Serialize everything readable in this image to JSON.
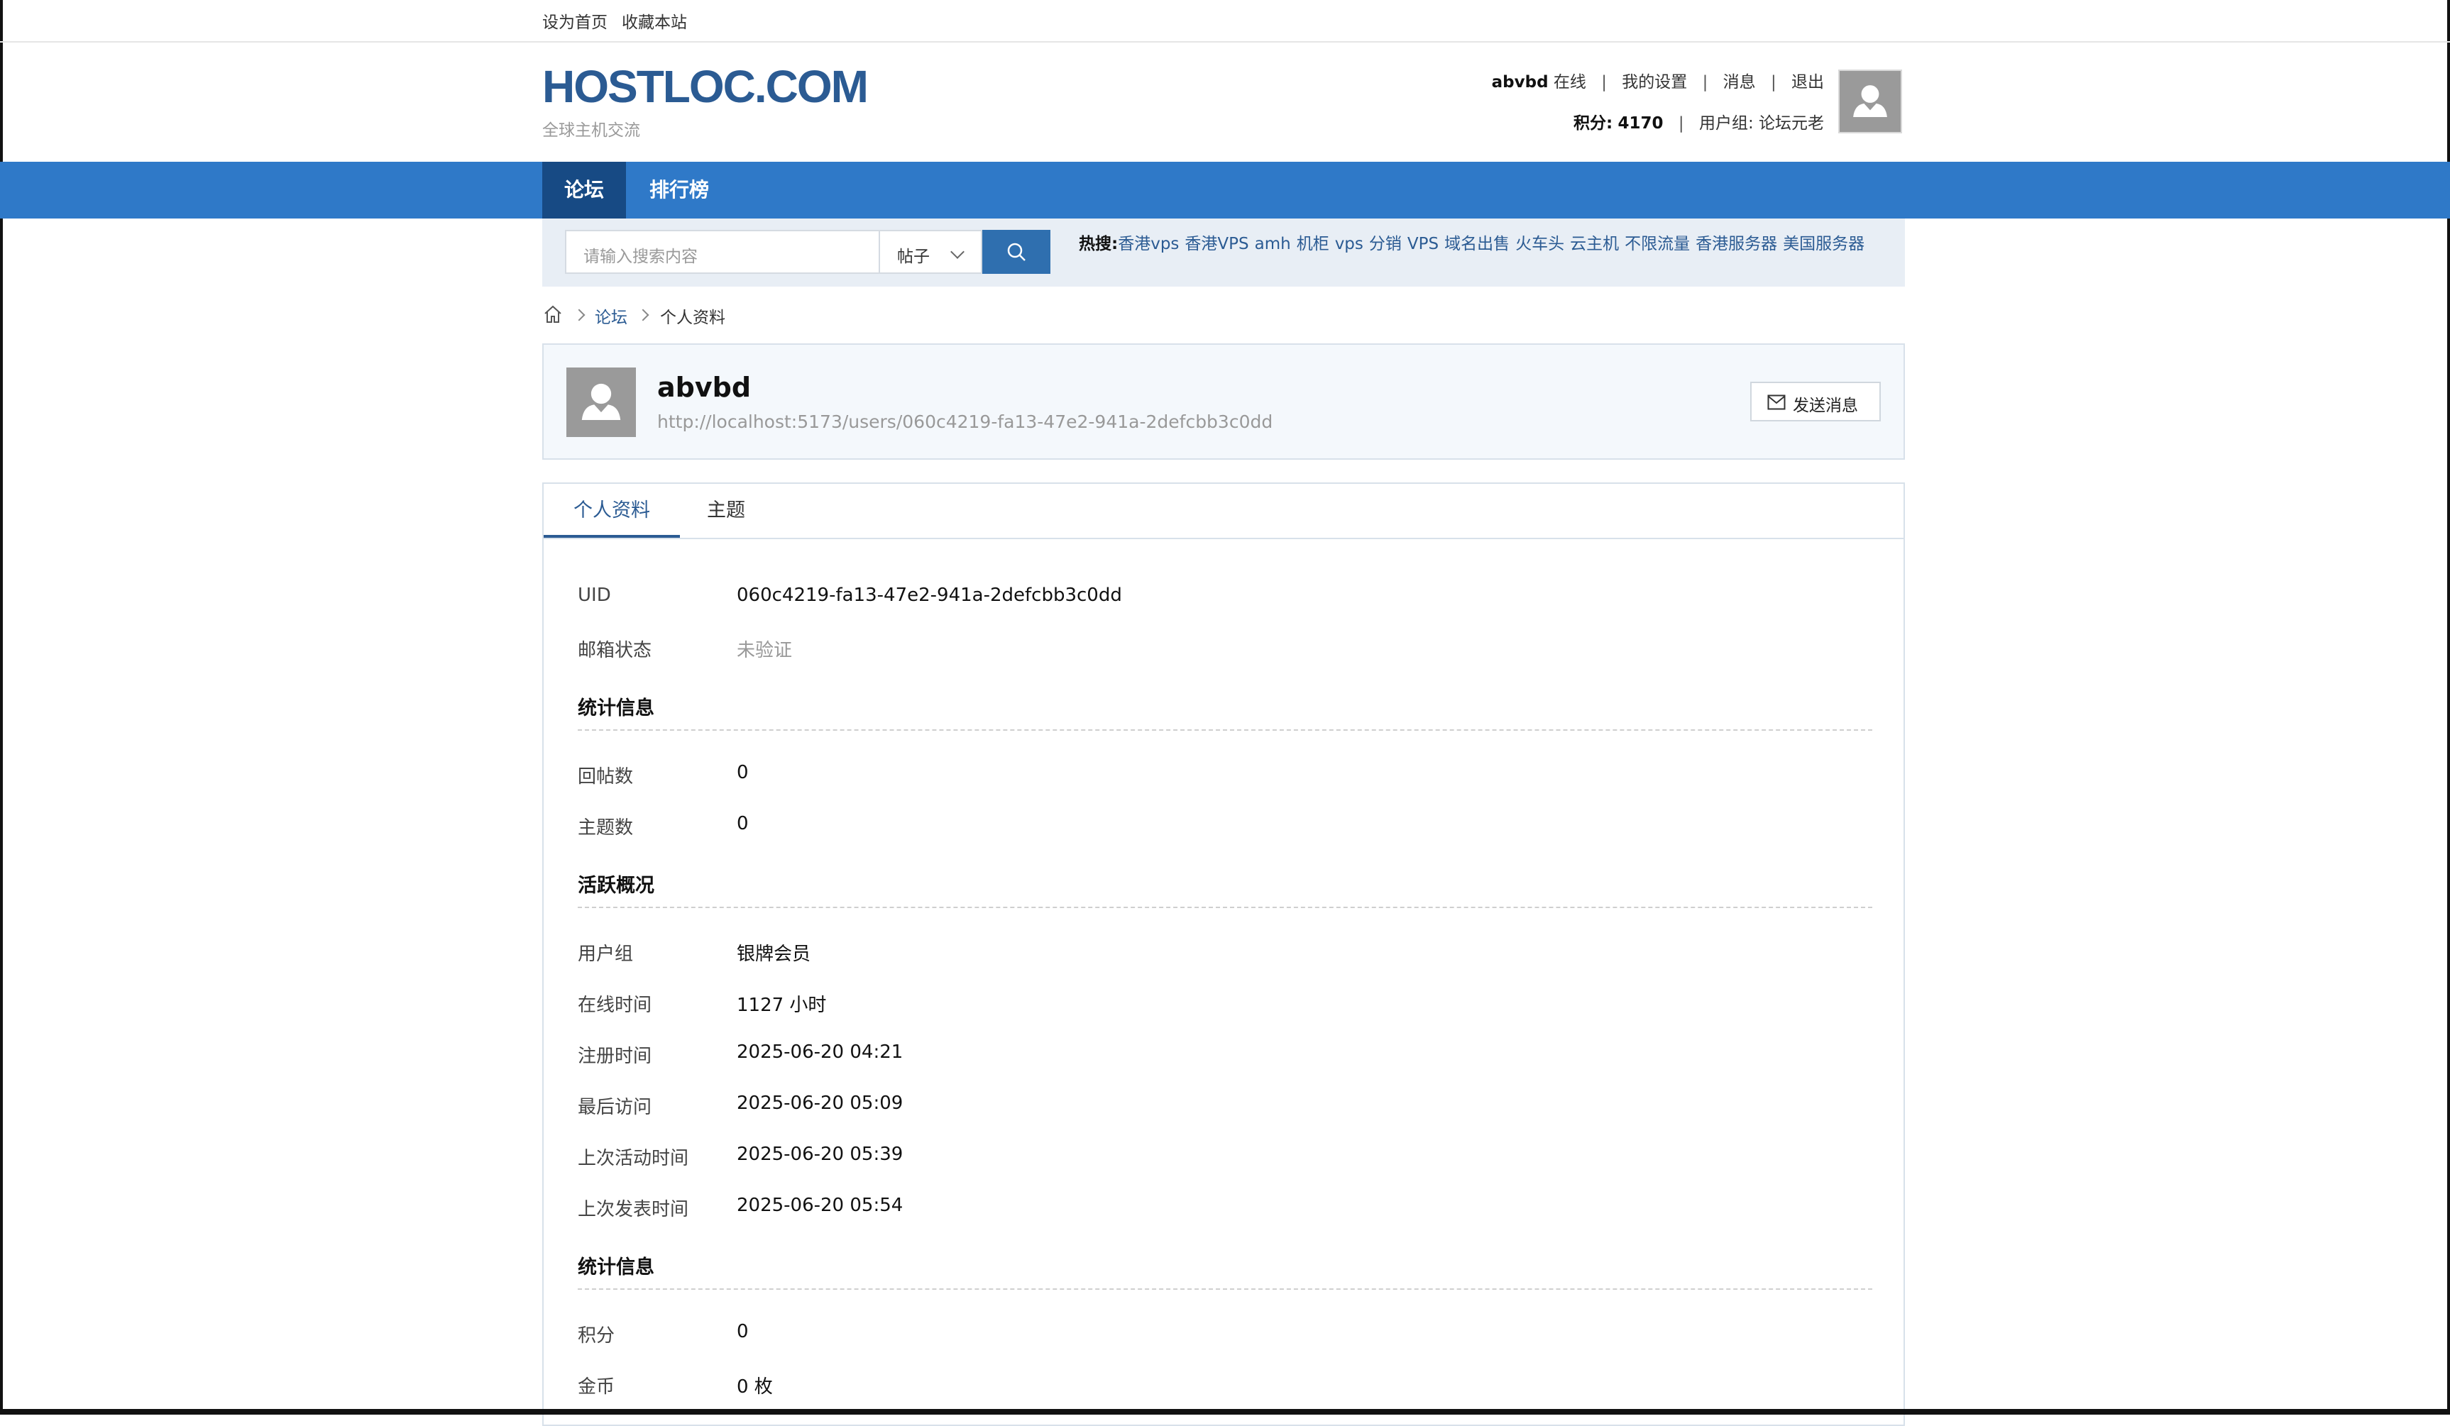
{
  "topbar": {
    "set_home": "设为首页",
    "bookmark": "收藏本站"
  },
  "header": {
    "logo": "HOSTLOC.COM",
    "slogan": "全球主机交流",
    "username": "abvbd",
    "online": "在线",
    "settings": "我的设置",
    "messages": "消息",
    "logout": "退出",
    "credit_label": "积分:",
    "credit_value": "4170",
    "group_label": "用户组:",
    "group_value": "论坛元老"
  },
  "nav": {
    "items": [
      {
        "label": "论坛",
        "active": true
      },
      {
        "label": "排行榜",
        "active": false
      }
    ]
  },
  "search": {
    "placeholder": "请输入搜索内容",
    "type": "帖子",
    "hot_label": "热搜:",
    "hot_terms": [
      "香港vps",
      "香港VPS",
      "amh",
      "机柜",
      "vps",
      "分销",
      "VPS",
      "域名出售",
      "火车头",
      "云主机",
      "不限流量",
      "香港服务器",
      "美国服务器"
    ]
  },
  "breadcrumb": {
    "forum": "论坛",
    "current": "个人资料"
  },
  "profile": {
    "name": "abvbd",
    "url": "http://localhost:5173/users/060c4219-fa13-47e2-941a-2defcbb3c0dd",
    "send_message": "发送消息"
  },
  "tabs": [
    {
      "label": "个人资料",
      "active": true
    },
    {
      "label": "主题",
      "active": false
    }
  ],
  "details": {
    "uid_label": "UID",
    "uid_value": "060c4219-fa13-47e2-941a-2defcbb3c0dd",
    "email_label": "邮箱状态",
    "email_value": "未验证",
    "stats_title": "统计信息",
    "replies_label": "回帖数",
    "replies_value": "0",
    "threads_label": "主题数",
    "threads_value": "0",
    "activity_title": "活跃概况",
    "group_label": "用户组",
    "group_value": "银牌会员",
    "online_label": "在线时间",
    "online_value": "1127 小时",
    "reg_label": "注册时间",
    "reg_value": "2025-06-20 04:21",
    "last_visit_label": "最后访问",
    "last_visit_value": "2025-06-20 05:09",
    "last_active_label": "上次活动时间",
    "last_active_value": "2025-06-20 05:39",
    "last_post_label": "上次发表时间",
    "last_post_value": "2025-06-20 05:54",
    "stats2_title": "统计信息",
    "credit_label": "积分",
    "credit_value": "0",
    "coin_label": "金币",
    "coin_value": "0 枚"
  },
  "colors": {
    "nav_bg": "#2f79c8",
    "nav_active": "#174a84",
    "link": "#2b5b93",
    "logo": "#2b5b93"
  }
}
